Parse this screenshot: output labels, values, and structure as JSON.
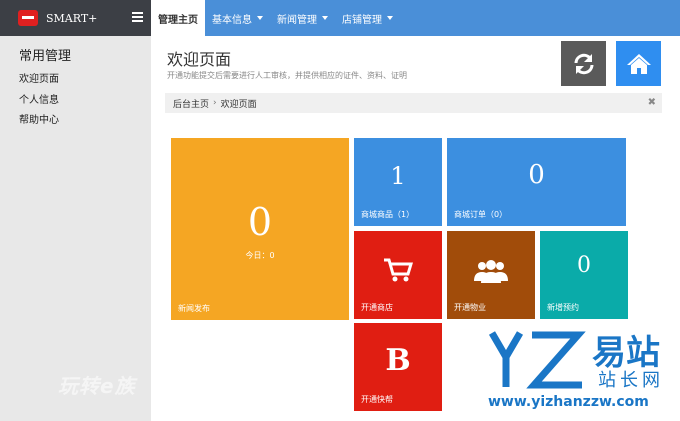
{
  "brand": {
    "name": "SMART+"
  },
  "nav": {
    "items": [
      {
        "label": "管理主页"
      },
      {
        "label": "基本信息"
      },
      {
        "label": "新闻管理"
      },
      {
        "label": "店铺管理"
      }
    ]
  },
  "sidebar": {
    "title": "常用管理",
    "items": [
      {
        "label": "欢迎页面"
      },
      {
        "label": "个人信息"
      },
      {
        "label": "帮助中心"
      }
    ]
  },
  "header": {
    "title": "欢迎页面",
    "subtitle": "开通功能提交后需要进行人工审核，并提供相应的证件、资料、证明"
  },
  "breadcrumb": {
    "home": "后台主页",
    "sep": "›",
    "current": "欢迎页面",
    "close": "✖"
  },
  "tiles": {
    "news": {
      "value": "0",
      "sub": "今日：0",
      "label": "新闻发布"
    },
    "products": {
      "value": "1",
      "label": "商城商品（1）"
    },
    "orders": {
      "value": "0",
      "label": "商城订单（0）"
    },
    "shop": {
      "label": "开通商店"
    },
    "property": {
      "label": "开通物业"
    },
    "booking": {
      "value": "0",
      "label": "新增预约"
    },
    "kuaibang": {
      "letter": "B",
      "label": "开通快帮"
    }
  },
  "colors": {
    "orange": "#f5a623",
    "blue": "#3c8fe0",
    "red": "#e01e12",
    "brown": "#a14c0a",
    "teal": "#0aaba9"
  },
  "watermarks": {
    "left": "玩转e族",
    "right_cn1": "易站",
    "right_cn2": "站长网",
    "right_url": "www.yizhanzzw.com"
  }
}
